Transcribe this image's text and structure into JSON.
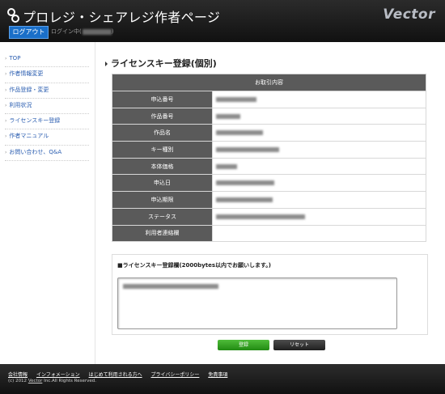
{
  "header": {
    "site_title": "プロレジ・シェアレジ作者ページ",
    "brand": "Vector",
    "logout_label": "ログアウト",
    "login_prefix": "ログイン中(",
    "login_suffix": ")"
  },
  "sidebar": {
    "items": [
      {
        "label": "TOP"
      },
      {
        "label": "作者情報変更"
      },
      {
        "label": "作品登録・変更"
      },
      {
        "label": "利用状況"
      },
      {
        "label": "ライセンスキー登録"
      },
      {
        "label": "作者マニュアル"
      },
      {
        "label": "お問い合わせ、Q&A"
      }
    ]
  },
  "main": {
    "heading": "ライセンスキー登録(個別)",
    "table_caption": "お取引内容",
    "rows": [
      {
        "label": "申込番号"
      },
      {
        "label": "作品番号"
      },
      {
        "label": "作品名"
      },
      {
        "label": "キー種別"
      },
      {
        "label": "本体価格"
      },
      {
        "label": "申込日"
      },
      {
        "label": "申込期限"
      },
      {
        "label": "ステータス"
      },
      {
        "label": "利用者連絡欄"
      }
    ],
    "registration_label": "■ライセンスキー登録欄(2000bytes以内でお願いします。)",
    "submit_label": "登録",
    "reset_label": "リセット"
  },
  "footer": {
    "links": [
      {
        "label": "会社情報"
      },
      {
        "label": "インフォメーション"
      },
      {
        "label": "はじめて利用される方へ"
      },
      {
        "label": "プライバシーポリシー"
      },
      {
        "label": "免責事項"
      }
    ],
    "copyright_prefix": "(c) 2012",
    "copyright_company": "Vector",
    "copyright_suffix": "Inc.All Rights Reserved."
  },
  "colors": {
    "header_bg": "#1c1c1c",
    "logout_button": "#1a6fc9",
    "sidebar_link": "#2a5db0",
    "table_header": "#5a5a5a",
    "submit_button": "#2f9a1f",
    "reset_button": "#2d2d2d"
  }
}
